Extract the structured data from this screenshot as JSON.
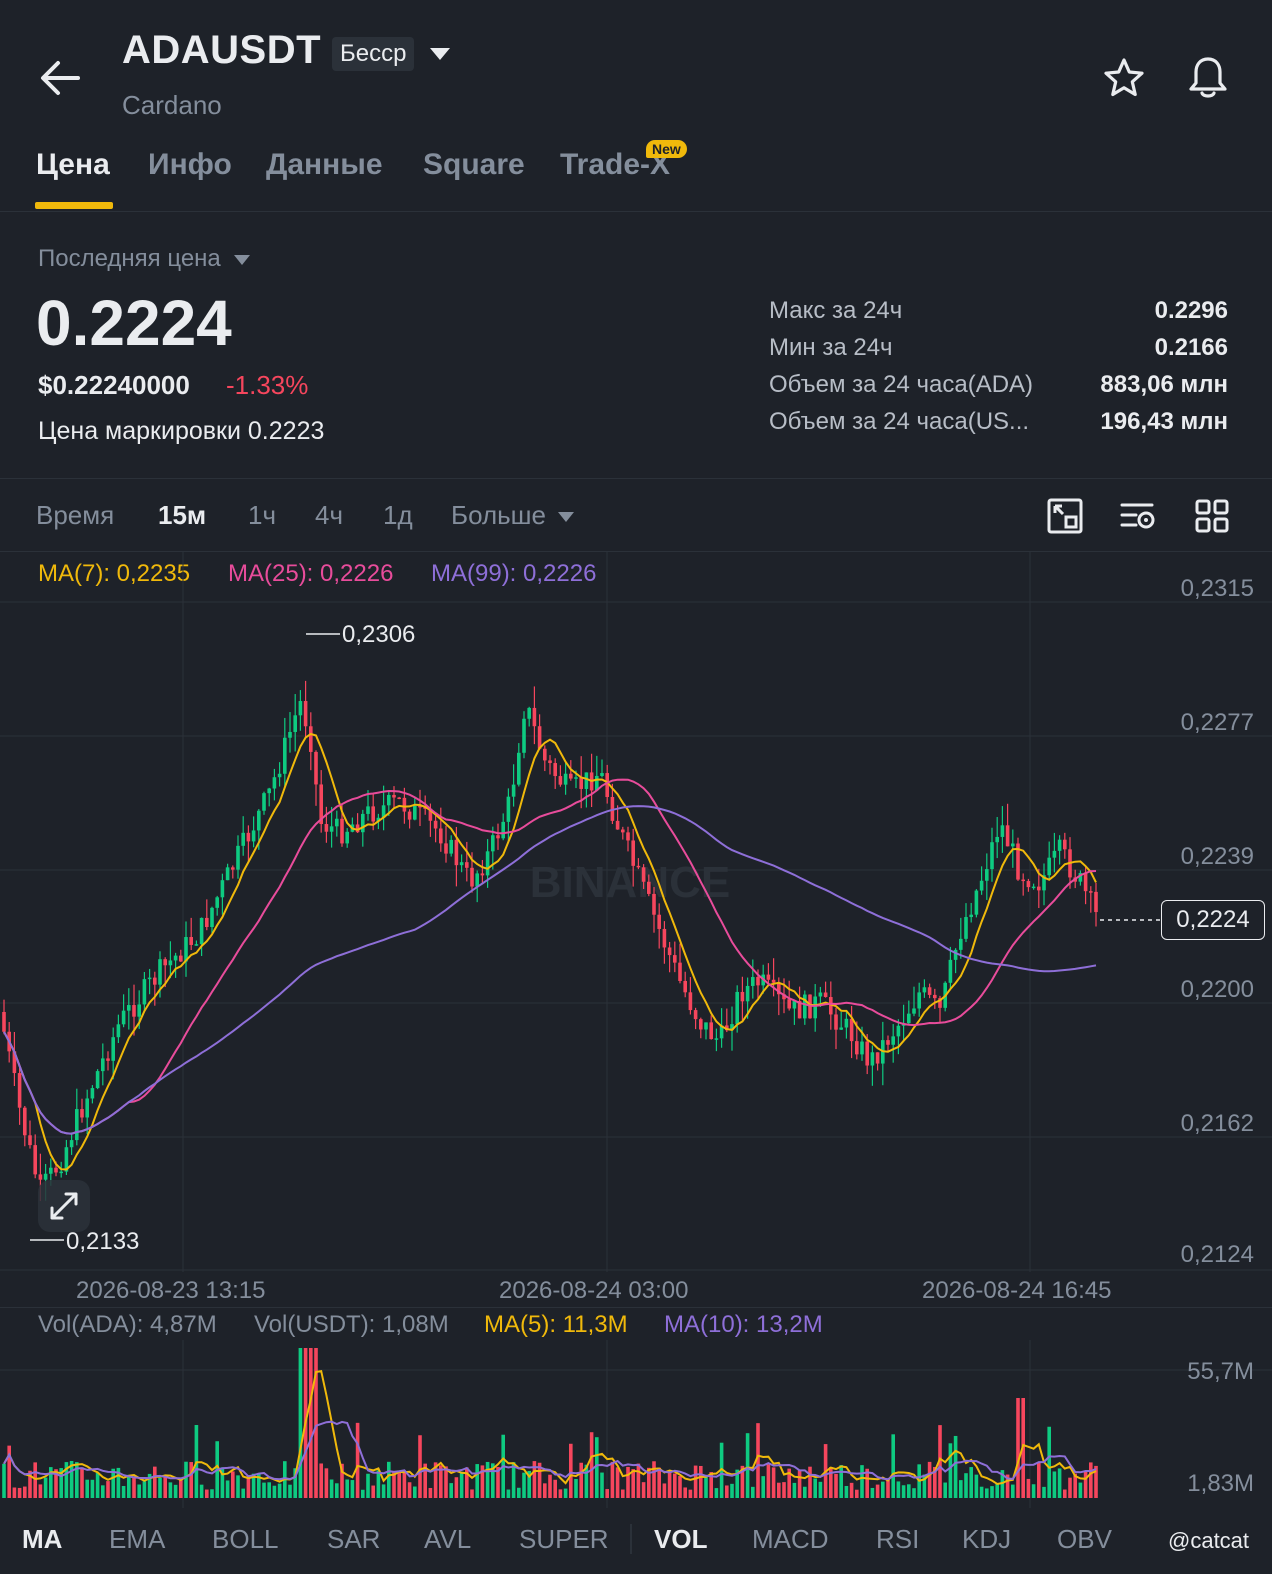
{
  "header": {
    "pair": "ADAUSDT",
    "badge": "Бесср",
    "subtitle": "Cardano"
  },
  "tabs": [
    {
      "label": "Цена",
      "active": true
    },
    {
      "label": "Инфо"
    },
    {
      "label": "Данные"
    },
    {
      "label": "Square"
    },
    {
      "label": "Trade-X",
      "badge": "New"
    }
  ],
  "price": {
    "selector_label": "Последняя цена",
    "last": "0.2224",
    "usd": "$0.22240000",
    "change": "-1.33%",
    "mark_label": "Цена маркировки",
    "mark_value": "0.2223"
  },
  "stats": [
    {
      "label": "Макс за 24ч",
      "value": "0.2296"
    },
    {
      "label": "Мин за 24ч",
      "value": "0.2166"
    },
    {
      "label": "Объем за 24 часа(ADA)",
      "value": "883,06 млн"
    },
    {
      "label": "Объем за 24 часа(US...",
      "value": "196,43 млн"
    }
  ],
  "timeframes": {
    "time_label": "Время",
    "items": [
      "15м",
      "1ч",
      "4ч",
      "1д"
    ],
    "active": "15м",
    "more_label": "Больше"
  },
  "ma_legend": {
    "ma7": "MA(7): 0,2235",
    "ma25": "MA(25): 0,2226",
    "ma99": "MA(99): 0,2226"
  },
  "colors": {
    "up": "#0ecb81",
    "down": "#f6465d",
    "ma7": "#f0b90b",
    "ma25": "#e84c9b",
    "ma99": "#8e6fd8",
    "accent": "#f0b90b"
  },
  "chart": {
    "y_ticks": [
      "0,2315",
      "0,2277",
      "0,2239",
      "0,2200",
      "0,2162",
      "0,2124"
    ],
    "x_ticks": [
      "2026-08-23 13:15",
      "2026-08-24 03:00",
      "2026-08-24 16:45"
    ],
    "high_label": "0,2306",
    "low_label": "0,2133",
    "current_price_tag": "0,2224",
    "watermark": "BINANCE"
  },
  "volume": {
    "vol_ada": "Vol(ADA): 4,87M",
    "vol_usdt": "Vol(USDT): 1,08M",
    "ma5": "MA(5): 11,3M",
    "ma10": "MA(10): 13,2M",
    "y_top": "55,7M",
    "y_bottom": "1,83M"
  },
  "indicators": {
    "main": [
      "MA",
      "EMA",
      "BOLL",
      "SAR",
      "AVL",
      "SUPER"
    ],
    "sub": [
      "VOL",
      "MACD",
      "RSI",
      "KDJ",
      "OBV"
    ],
    "active_main": "MA",
    "active_sub": "VOL"
  },
  "footer": {
    "watermark_user": "@catcat"
  }
}
